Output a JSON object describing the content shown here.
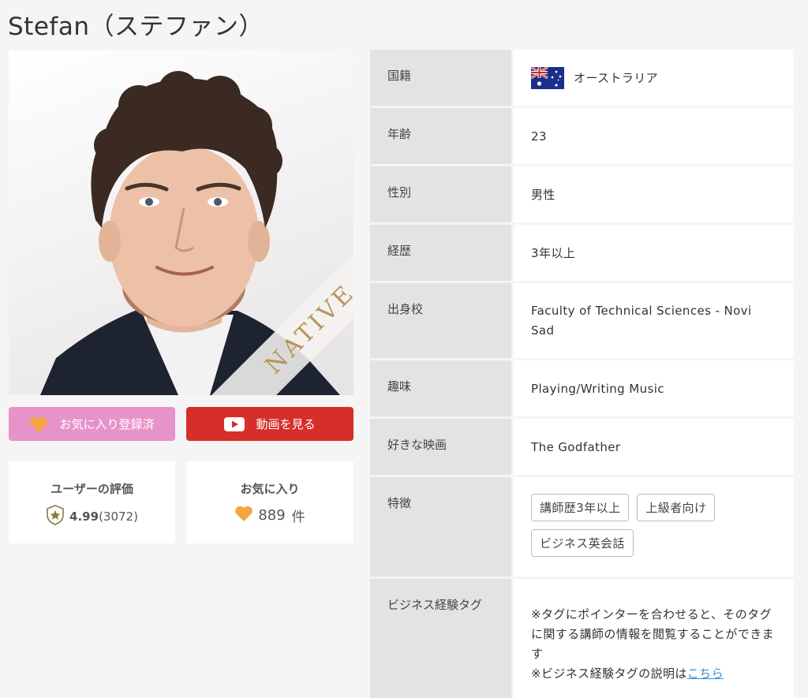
{
  "page": {
    "title": "Stefan（ステファン）"
  },
  "photo": {
    "badge": "NATIVE"
  },
  "buttons": {
    "favorite_label": "お気に入り登録済",
    "video_label": "動画を見る"
  },
  "stats": {
    "rating_label": "ユーザーの評価",
    "rating_value": "4.99",
    "rating_count": "(3072)",
    "favorites_label": "お気に入り",
    "favorites_value": "889",
    "favorites_unit": "件"
  },
  "profile": {
    "nationality": {
      "label": "国籍",
      "value": "オーストラリア",
      "flag": "australia-flag"
    },
    "age": {
      "label": "年齢",
      "value": "23"
    },
    "gender": {
      "label": "性別",
      "value": "男性"
    },
    "career": {
      "label": "経歴",
      "value": "3年以上"
    },
    "school": {
      "label": "出身校",
      "value": "Faculty of Technical Sciences - Novi Sad"
    },
    "hobby": {
      "label": "趣味",
      "value": "Playing/Writing Music"
    },
    "movie": {
      "label": "好きな映画",
      "value": "The Godfather"
    },
    "features": {
      "label": "特徴",
      "tags": [
        "講師歴3年以上",
        "上級者向け",
        "ビジネス英会話"
      ]
    },
    "business_tags": {
      "label": "ビジネス経験タグ",
      "note_line1": "※タグにポインターを合わせると、そのタグに関する講師の情報を閲覧することができます",
      "note_line2_prefix": "※ビジネス経験タグの説明は",
      "note_link": "こちら"
    }
  },
  "colors": {
    "favorite_button": "#e793c9",
    "video_button": "#d62e2a",
    "heart": "#f5a540",
    "link": "#2f8fd8",
    "badge_gold": "#b8945a"
  }
}
